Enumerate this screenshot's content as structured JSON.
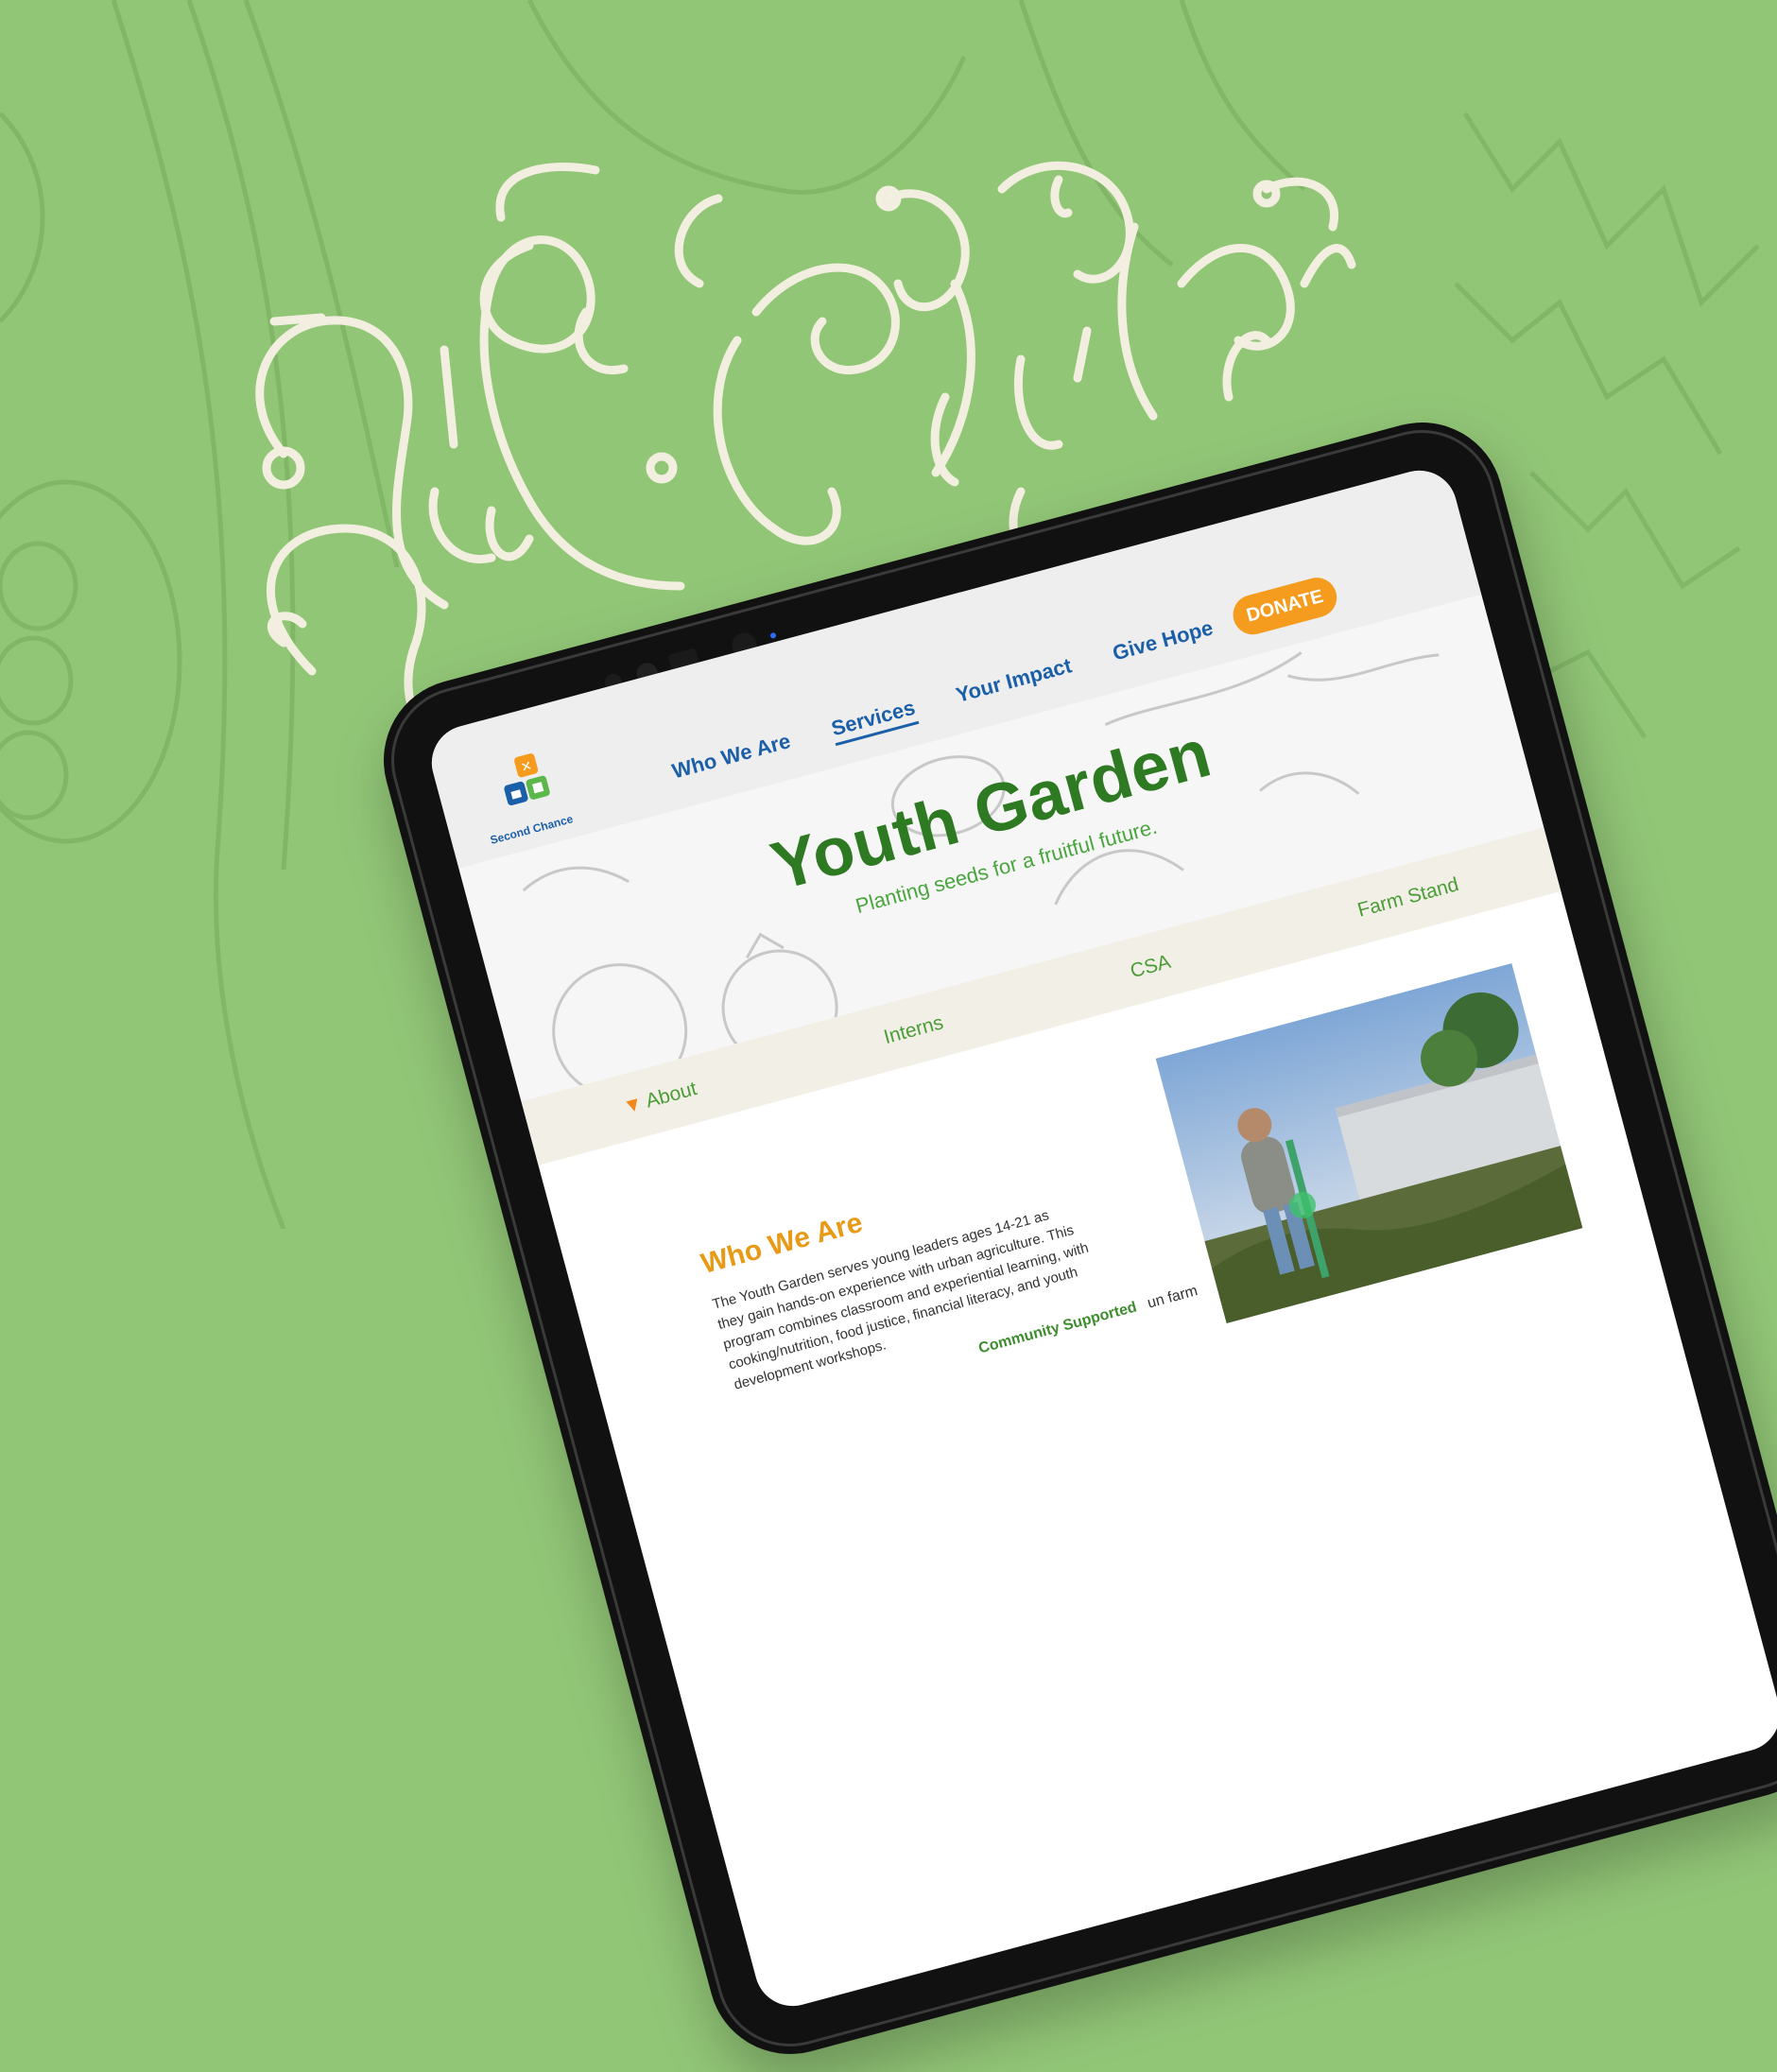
{
  "brand": {
    "name": "Second Chance",
    "accent": "#1b5fa8",
    "green": "#2e7a22",
    "orange": "#f59c1f",
    "background": "#92c677"
  },
  "nav": {
    "items": [
      {
        "label": "Who We Are",
        "active": false
      },
      {
        "label": "Services",
        "active": true
      },
      {
        "label": "Your Impact",
        "active": false
      },
      {
        "label": "Give Hope",
        "active": false
      }
    ],
    "donate_label": "DONATE"
  },
  "hero": {
    "title": "Youth Garden",
    "subtitle": "Planting seeds for a fruitful future."
  },
  "subnav": {
    "items": [
      {
        "label": "About",
        "icon": "carrot-icon"
      },
      {
        "label": "Interns"
      },
      {
        "label": "CSA"
      },
      {
        "label": "Farm Stand"
      }
    ]
  },
  "content": {
    "heading": "Who We Are",
    "body": "The Youth Garden serves young leaders ages 14-21 as they gain hands-on experience with urban agriculture. This program combines classroom and experiential learning, with cooking/nutrition, food justice, financial literacy, and youth development workshops.",
    "csa_link": "Community Supported",
    "csa_tail": "un farm"
  }
}
